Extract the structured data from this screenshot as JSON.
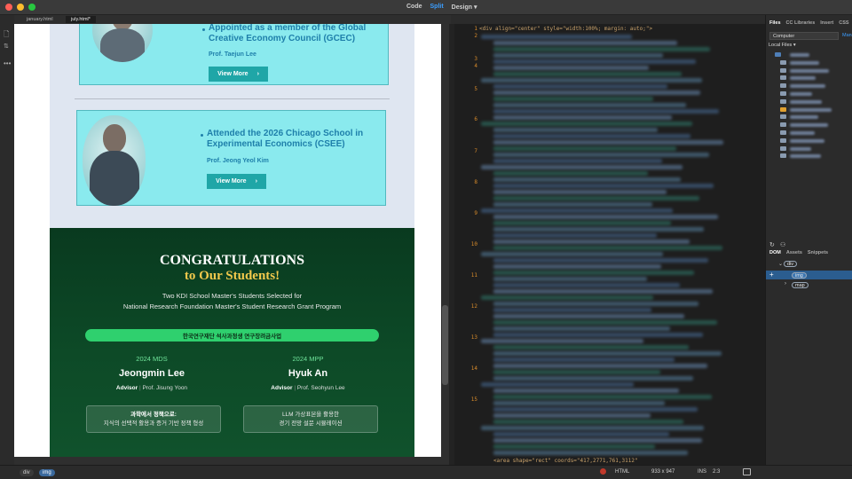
{
  "window": {
    "modes": [
      "Code",
      "Split",
      "Design"
    ],
    "active_mode": "Split",
    "design_caret": "▾"
  },
  "doc_tabs": [
    "january.html",
    "july.html*"
  ],
  "newsletter": {
    "card1": {
      "title_line1": "Appointed as a member of the Global",
      "title_line2": "Creative Economy Council (GCEC)",
      "prof": "Prof. Taejun Lee",
      "button": "View More",
      "chevron": "›"
    },
    "card2": {
      "title_line1": "Attended the 2026 Chicago School in",
      "title_line2": "Experimental Economics (CSEE)",
      "prof": "Prof. Jeong Yeol Kim",
      "button": "View More",
      "chevron": "›"
    },
    "congrats": {
      "line1": "CONGRATULATIONS",
      "line2": "to Our Students!",
      "sub1": "Two KDI School Master's Students Selected for",
      "sub2": "National Research Foundation Master's Student Research Grant Program",
      "pill": "한국연구재단 석사과정생 연구장려금사업",
      "students": [
        {
          "program": "2024 MDS",
          "name": "Jeongmin Lee",
          "advisor_label": "Advisor",
          "advisor": "Prof. Jisung Yoon",
          "topic1": "과학에서 정책으로:",
          "topic2": "지식의 선택적 활용과 증거 기반 정책 형성"
        },
        {
          "program": "2024 MPP",
          "name": "Hyuk An",
          "advisor_label": "Advisor",
          "advisor": "Prof. Seohyun Lee",
          "topic1": "LLM 가상표본을 활용한",
          "topic2": "경기 전망 설문 시뮬레이션"
        }
      ]
    }
  },
  "code": {
    "line_numbers": [
      "1",
      "2",
      "3",
      "4",
      "5",
      "6",
      "7",
      "8",
      "9",
      "10",
      "11",
      "12",
      "13",
      "14",
      "15"
    ],
    "line1": "<div align=\"center\" style=\"width:100%; margin: auto;\">",
    "last_line": "<area shape=\"rect\" coords=\"417,2771,761,3112\""
  },
  "status": {
    "crumbs": [
      "div",
      "img"
    ],
    "language": "HTML",
    "size": "933 x 947",
    "mode": "INS",
    "position": "2:3"
  },
  "panel": {
    "tabs": [
      "Files",
      "CC Libraries",
      "Insert",
      "CSS"
    ],
    "location": "Computer",
    "manage": "Man",
    "local_files": "Local Files ▾",
    "dom_tabs": [
      "DOM",
      "Assets",
      "Snippets"
    ],
    "dom_nodes": [
      "div",
      "img",
      "map"
    ]
  },
  "colors": {
    "accent": "#3b9eff",
    "card_bg": "#8aeaee",
    "card_text": "#1e7faa",
    "button": "#1fa6a7",
    "green_bg": "#0d4a27",
    "gold": "#f2c94c",
    "pill": "#2fd06e",
    "line_number": "#d98c2b"
  }
}
